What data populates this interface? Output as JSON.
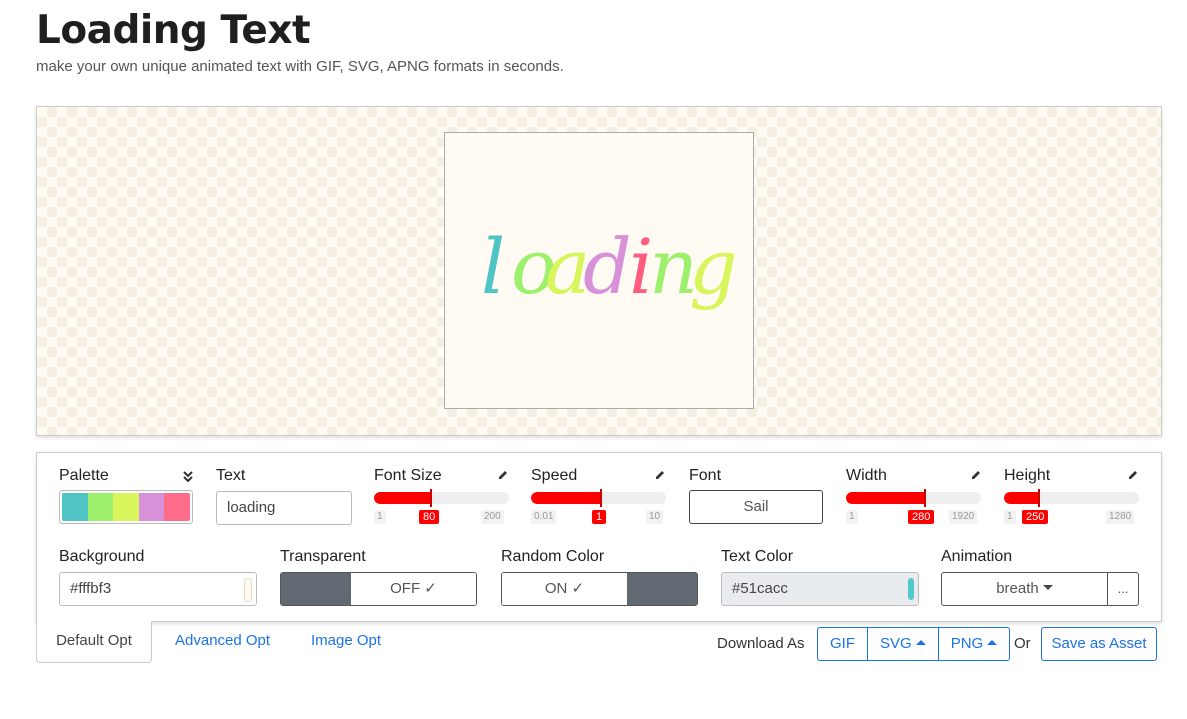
{
  "header": {
    "title": "Loading Text",
    "subtitle": "make your own unique animated text with GIF, SVG, APNG formats in seconds."
  },
  "preview": {
    "text": "loading",
    "letters": [
      {
        "ch": "l",
        "color": "#4fc4c4"
      },
      {
        "ch": "o",
        "color": "#9cf06b"
      },
      {
        "ch": "a",
        "color": "#d8f55c"
      },
      {
        "ch": "d",
        "color": "#d890d8"
      },
      {
        "ch": "i",
        "color": "#ff5c80"
      },
      {
        "ch": "n",
        "color": "#9cf06b"
      },
      {
        "ch": "g",
        "color": "#d8f55c"
      }
    ],
    "background": "#fffbf3"
  },
  "controls": {
    "palette": {
      "label": "Palette",
      "colors": [
        "#4fc4c4",
        "#9cf06b",
        "#d8f55c",
        "#d890d8",
        "#ff6b8a"
      ],
      "expand_icon": "double-chevron-down-icon"
    },
    "text": {
      "label": "Text",
      "value": "loading"
    },
    "font_size": {
      "label": "Font Size",
      "min": "1",
      "value": "80",
      "max": "200",
      "fraction": 0.4
    },
    "speed": {
      "label": "Speed",
      "min": "0.01",
      "value": "1",
      "max": "10",
      "fraction": 0.5
    },
    "font": {
      "label": "Font",
      "value": "Sail"
    },
    "width": {
      "label": "Width",
      "min": "1",
      "value": "280",
      "max": "1920",
      "fraction": 0.58
    },
    "height": {
      "label": "Height",
      "min": "1",
      "value": "250",
      "max": "1280",
      "fraction": 0.26
    },
    "edit_icon": "pencil-icon",
    "background": {
      "label": "Background",
      "value": "#fffbf3"
    },
    "transparent": {
      "label": "Transparent",
      "value": "OFF"
    },
    "random_color": {
      "label": "Random Color",
      "value": "ON"
    },
    "text_color": {
      "label": "Text Color",
      "value": "#51cacc",
      "swatch": "#51cacc"
    },
    "animation": {
      "label": "Animation",
      "value": "breath",
      "more": "..."
    }
  },
  "tabs": {
    "default": "Default Opt",
    "advanced": "Advanced Opt",
    "image": "Image Opt"
  },
  "download": {
    "label": "Download As",
    "gif": "GIF",
    "svg": "SVG",
    "png": "PNG",
    "or": "Or",
    "asset": "Save as Asset"
  }
}
